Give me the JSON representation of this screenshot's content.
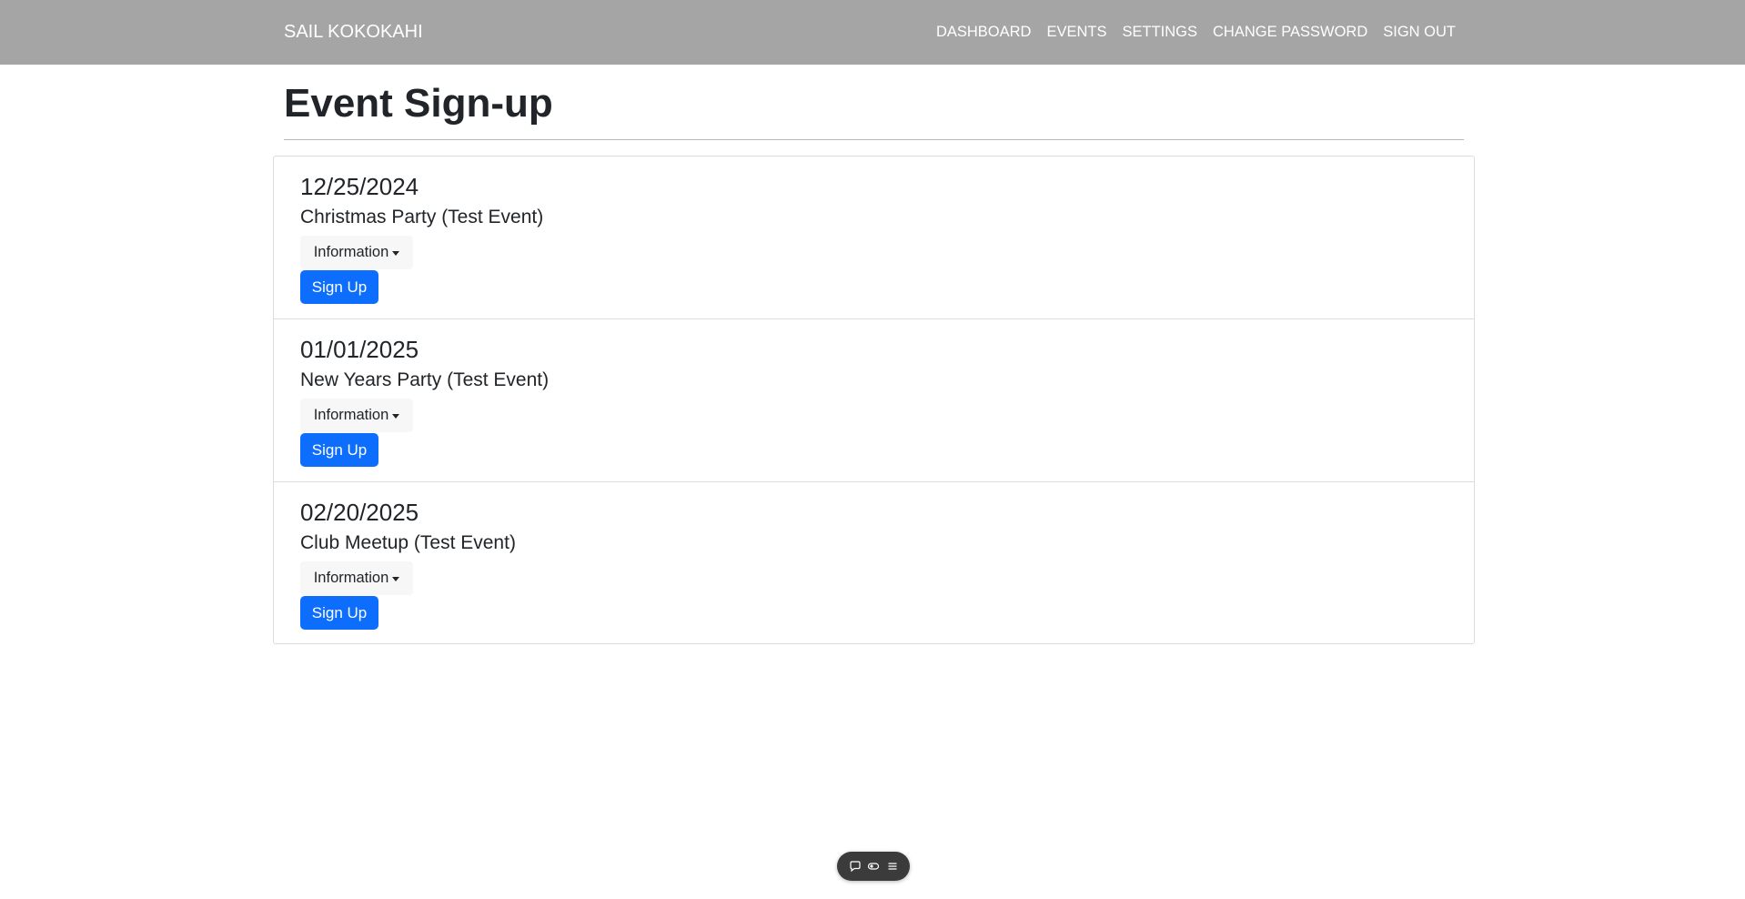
{
  "navbar": {
    "brand": "SAIL KOKOKAHI",
    "links": [
      "DASHBOARD",
      "EVENTS",
      "SETTINGS",
      "CHANGE PASSWORD",
      "SIGN OUT"
    ]
  },
  "page": {
    "title": "Event Sign-up"
  },
  "events": [
    {
      "date": "12/25/2024",
      "name": "Christmas Party (Test Event)",
      "info_label": "Information",
      "signup_label": "Sign Up"
    },
    {
      "date": "01/01/2025",
      "name": "New Years Party (Test Event)",
      "info_label": "Information",
      "signup_label": "Sign Up"
    },
    {
      "date": "02/20/2025",
      "name": "Club Meetup (Test Event)",
      "info_label": "Information",
      "signup_label": "Sign Up"
    }
  ],
  "toolbar": {
    "icons": [
      "comment-icon",
      "toggle-icon",
      "menu-icon"
    ]
  },
  "colors": {
    "navbar_bg": "#a5a5a5",
    "primary": "#0d6efd",
    "text": "#212529"
  }
}
